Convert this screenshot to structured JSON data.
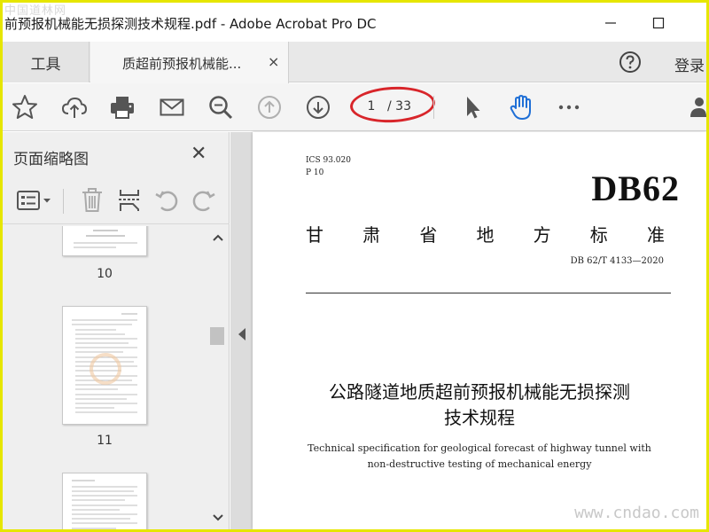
{
  "window": {
    "title": "前预报机械能无损探测技术规程.pdf - Adobe Acrobat Pro DC",
    "watermark": "中国道林网"
  },
  "tabs": {
    "tools_label": "工具",
    "document_label": "质超前预报机械能...",
    "close_symbol": "×",
    "signin_label": "登录"
  },
  "toolbar": {
    "current_page": "1",
    "total_pages": "/ 33",
    "highlight_color": "#d8252a"
  },
  "panel": {
    "title": "页面缩略图",
    "close_symbol": "✕",
    "thumbnails": [
      {
        "number": "10"
      },
      {
        "number": "11"
      },
      {
        "number": ""
      }
    ]
  },
  "document": {
    "ics": "ICS 93.020",
    "category": "P 10",
    "standard_code": "DB62",
    "province_chars": [
      "甘",
      "肃",
      "省",
      "地",
      "方",
      "标",
      "准"
    ],
    "standard_number": "DB 62/T 4133—2020",
    "title_cn_line1": "公路隧道地质超前预报机械能无损探测",
    "title_cn_line2": "技术规程",
    "title_en_line1": "Technical specification for geological forecast of highway tunnel with",
    "title_en_line2": "non-destructive testing of mechanical energy"
  },
  "watermark_bottom": "www.cndao.com",
  "colors": {
    "frame": "#e6e600",
    "hand_tool": "#1f6fd6",
    "ellipse": "#d8252a"
  }
}
